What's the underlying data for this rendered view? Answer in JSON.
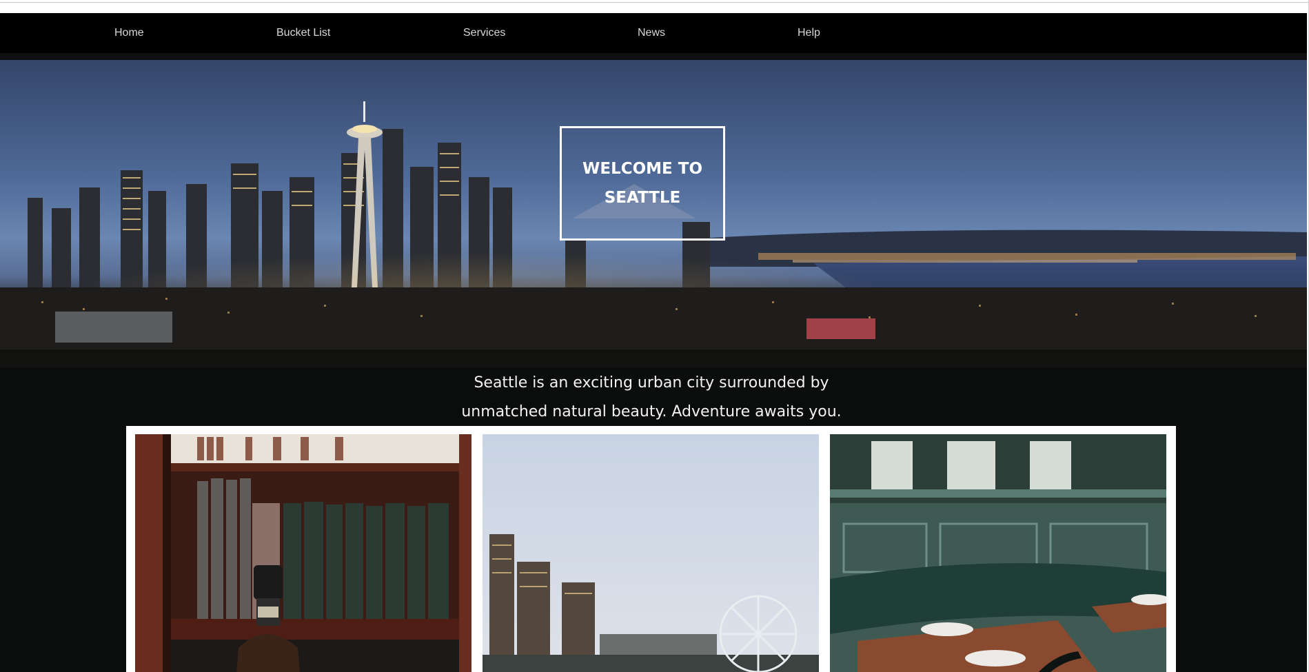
{
  "nav": {
    "items": [
      {
        "label": "Home"
      },
      {
        "label": "Bucket List"
      },
      {
        "label": "Services"
      },
      {
        "label": "News"
      },
      {
        "label": "Help"
      }
    ]
  },
  "hero": {
    "welcome_line1": "WELCOME TO",
    "welcome_line2": "SEATTLE"
  },
  "intro": {
    "line1": "Seattle is an exciting urban city surrounded by",
    "line2": "unmatched natural beauty. Adventure awaits you."
  },
  "gallery": {
    "tiles": [
      {
        "icon": "bookshelf-bottle-photo"
      },
      {
        "icon": "waterfront-ferris-wheel-photo"
      },
      {
        "icon": "restaurant-booth-photo"
      }
    ]
  },
  "colors": {
    "navbar": "#000000",
    "page_background": "#0b0d0c",
    "nav_text": "#d8d8d8",
    "frame": "#ffffff"
  }
}
